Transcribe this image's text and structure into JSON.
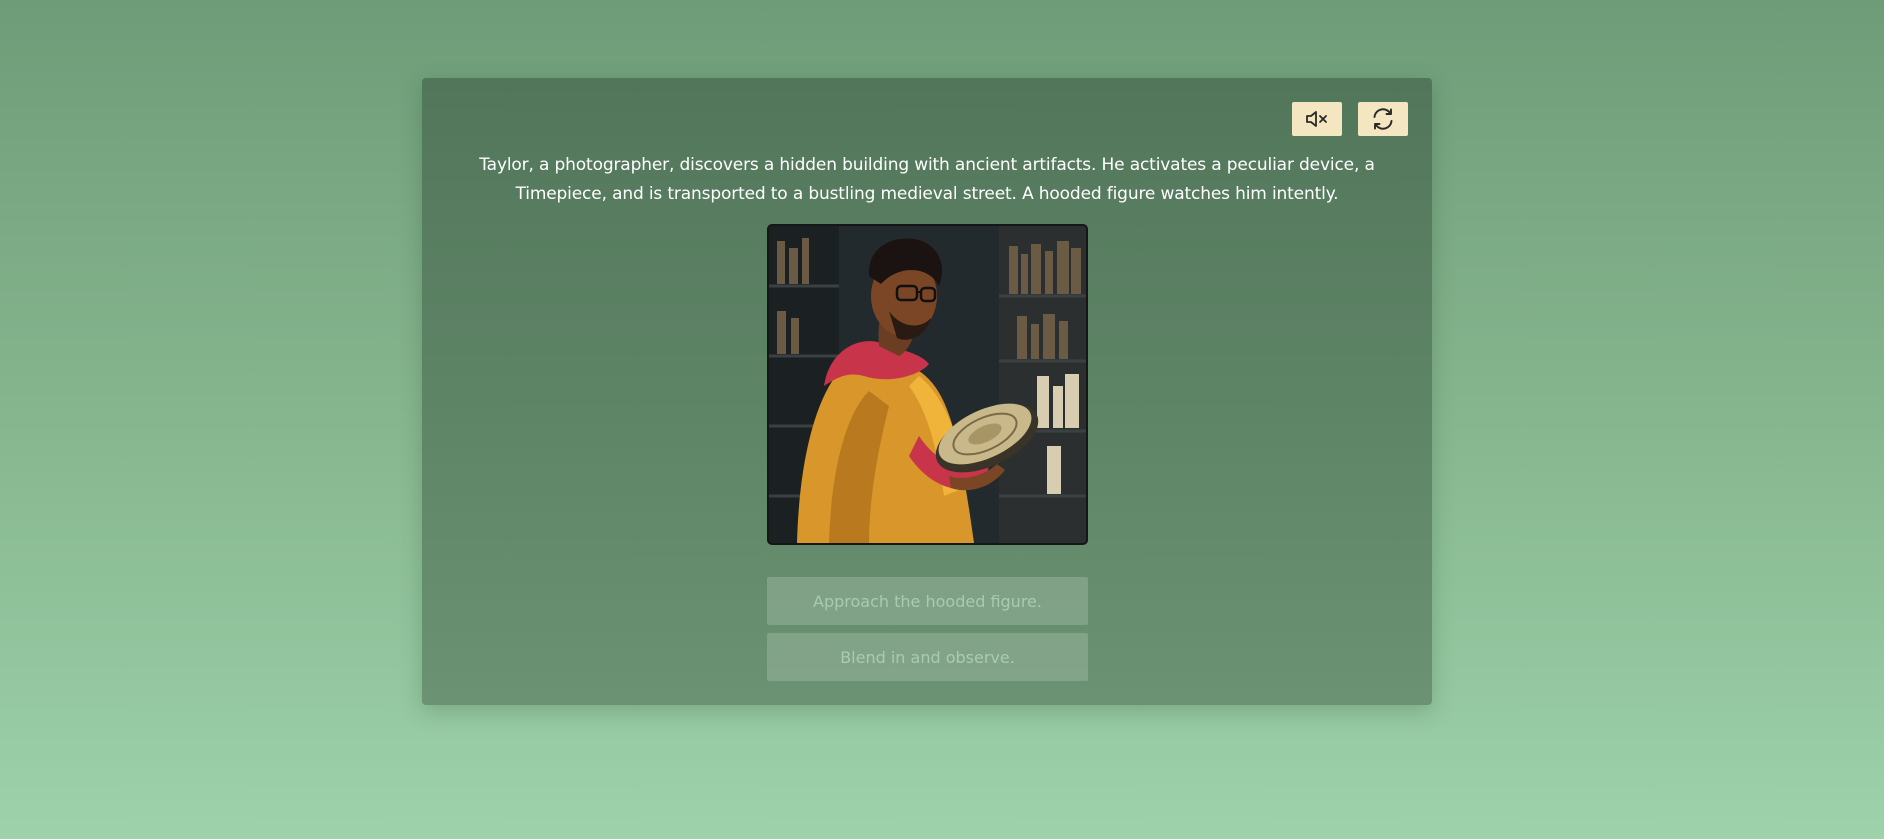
{
  "controls": {
    "mute_icon": "speaker-muted-icon",
    "restart_icon": "refresh-icon"
  },
  "story": {
    "text": "Taylor, a photographer, discovers a hidden building with ancient artifacts. He activates a peculiar device, a Timepiece, and is transported to a bustling medieval street. A hooded figure watches him intently."
  },
  "scene_image": {
    "description_icon": "story-illustration"
  },
  "choices": [
    {
      "label": "Approach the hooded figure."
    },
    {
      "label": "Blend in and observe."
    }
  ],
  "colors": {
    "button_bg": "#f4e6c1",
    "panel_bg": "#5e8466",
    "page_bg_top": "#6e9c78",
    "page_bg_bottom": "#9dd2aa"
  }
}
